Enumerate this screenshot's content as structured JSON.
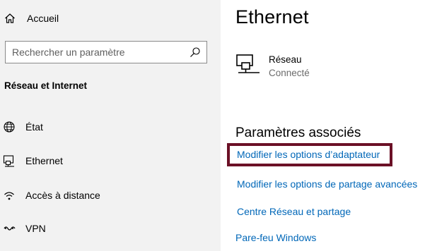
{
  "sidebar": {
    "home_label": "Accueil",
    "search_placeholder": "Rechercher un paramètre",
    "section_title": "Réseau et Internet",
    "items": [
      {
        "label": "État",
        "icon": "globe-icon"
      },
      {
        "label": "Ethernet",
        "icon": "ethernet-icon"
      },
      {
        "label": "Accès à distance",
        "icon": "dialup-icon"
      },
      {
        "label": "VPN",
        "icon": "vpn-icon"
      }
    ]
  },
  "main": {
    "title": "Ethernet",
    "network": {
      "name": "Réseau",
      "status": "Connecté"
    },
    "related_title": "Paramètres associés",
    "links": [
      "Modifier les options d’adaptateur",
      "Modifier les options de partage avancées",
      "Centre Réseau et partage",
      "Pare-feu Windows"
    ]
  },
  "colors": {
    "sidebar_bg": "#f2f2f2",
    "link": "#0067b8",
    "highlight": "#6b1026",
    "status_text": "#6b6b6b"
  }
}
